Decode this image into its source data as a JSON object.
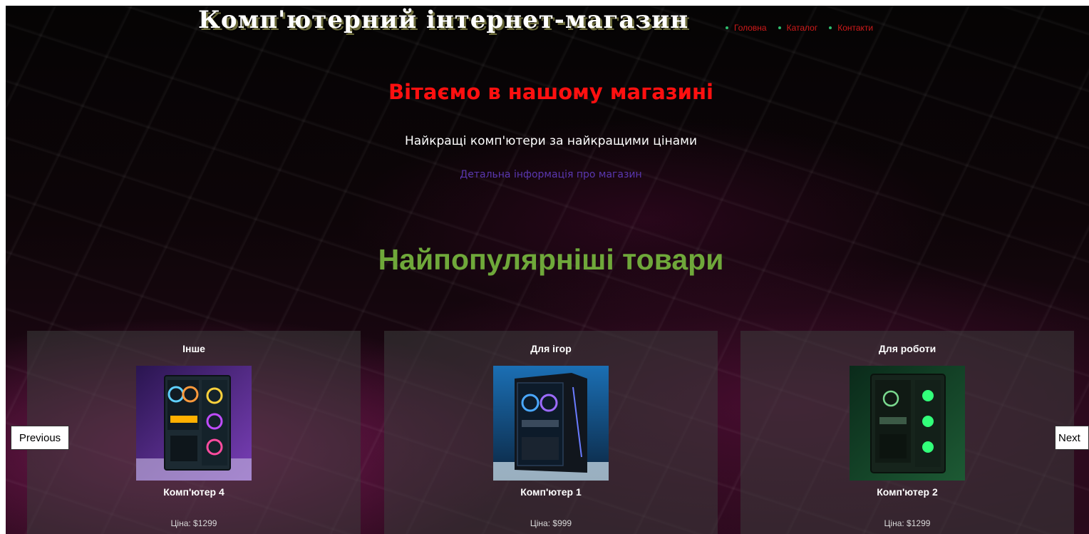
{
  "header": {
    "title": "Комп'ютерний інтернет-магазин",
    "nav": [
      {
        "label": "Головна"
      },
      {
        "label": "Каталог"
      },
      {
        "label": "Контакти"
      }
    ]
  },
  "hero": {
    "welcome": "Вітаємо в нашому магазині",
    "tagline": "Найкращі комп'ютери за найкращими цінами",
    "info_link": "Детальна інформація про магазин"
  },
  "popular": {
    "heading": "Найпопулярніші товари",
    "prev_label": "Previous",
    "next_label": "Next",
    "products": [
      {
        "category": "Інше",
        "name": "Комп'ютер 4",
        "price": "Ціна: $1299",
        "image": "pc-case-purple-rgb"
      },
      {
        "category": "Для ігор",
        "name": "Комп'ютер 1",
        "price": "Ціна: $999",
        "image": "pc-case-blue-rgb"
      },
      {
        "category": "Для роботи",
        "name": "Комп'ютер 2",
        "price": "Ціна: $1299",
        "image": "pc-case-green-rgb"
      }
    ]
  },
  "colors": {
    "title_shadow": "#6b6a3a",
    "nav_link": "#d11a1a",
    "nav_bullet": "#2fbf6f",
    "welcome": "#ff1010",
    "info_link": "#5a37b0",
    "popular_heading": "#6fa83a"
  }
}
